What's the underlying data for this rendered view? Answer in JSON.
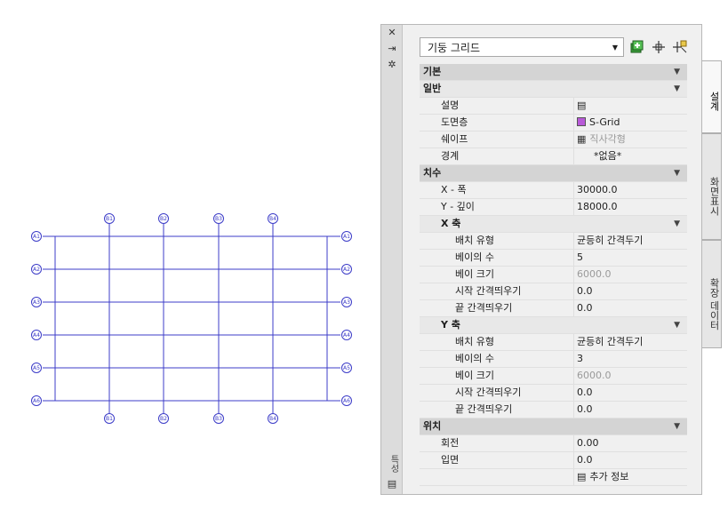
{
  "palette": {
    "strip": {
      "close": "✕",
      "pin": "⇥",
      "settings": "✲",
      "label": "특성",
      "bottom_icon": "▤"
    },
    "style_select": {
      "value": "기둥 그리드"
    },
    "tools": [
      "add-style-icon",
      "pick-point-icon",
      "quick-select-icon"
    ],
    "tabs": [
      "설계",
      "화면표시",
      "확장 데이터"
    ],
    "sections": {
      "basic": "기본",
      "general": "일반",
      "general_rows": [
        {
          "label": "설명",
          "value": "",
          "icon": "description-icon"
        },
        {
          "label": "도면층",
          "value": "S-Grid",
          "icon": "layer-color-swatch",
          "color": "#b85ad8"
        },
        {
          "label": "쉐이프",
          "value": "직사각형",
          "icon": "grid-shape-icon",
          "dim": true
        },
        {
          "label": "경계",
          "value": "*없음*"
        }
      ],
      "dimensions": "치수",
      "dimension_rows": [
        {
          "label": "X - 폭",
          "value": "30000.0"
        },
        {
          "label": "Y - 깊이",
          "value": "18000.0"
        }
      ],
      "x_axis": "X 축",
      "x_rows": [
        {
          "label": "배치 유형",
          "value": "균등히 간격두기"
        },
        {
          "label": "베이의 수",
          "value": "5"
        },
        {
          "label": "베이 크기",
          "value": "6000.0",
          "dim": true
        },
        {
          "label": "시작 간격띄우기",
          "value": "0.0"
        },
        {
          "label": "끝 간격띄우기",
          "value": "0.0"
        }
      ],
      "y_axis": "Y 축",
      "y_rows": [
        {
          "label": "배치 유형",
          "value": "균등히 간격두기"
        },
        {
          "label": "베이의 수",
          "value": "3"
        },
        {
          "label": "베이 크기",
          "value": "6000.0",
          "dim": true
        },
        {
          "label": "시작 간격띄우기",
          "value": "0.0"
        },
        {
          "label": "끝 간격띄우기",
          "value": "0.0"
        }
      ],
      "location": "위치",
      "location_rows": [
        {
          "label": "회전",
          "value": "0.00"
        },
        {
          "label": "입면",
          "value": "0.0"
        },
        {
          "label": "",
          "value": "추가 정보",
          "icon": "additional-info-icon"
        }
      ]
    }
  },
  "grid": {
    "line_color": "#3c3cc8",
    "top_bubbles": [
      "B1",
      "B2",
      "B3",
      "B4"
    ],
    "bottom_bubbles": [
      "B1",
      "B2",
      "B3",
      "B4"
    ],
    "left_bubbles": [
      "A1",
      "A2",
      "A3",
      "A4",
      "A5",
      "A6"
    ],
    "right_bubbles": [
      "A1",
      "A2",
      "A3",
      "A4",
      "A5",
      "A6"
    ]
  }
}
